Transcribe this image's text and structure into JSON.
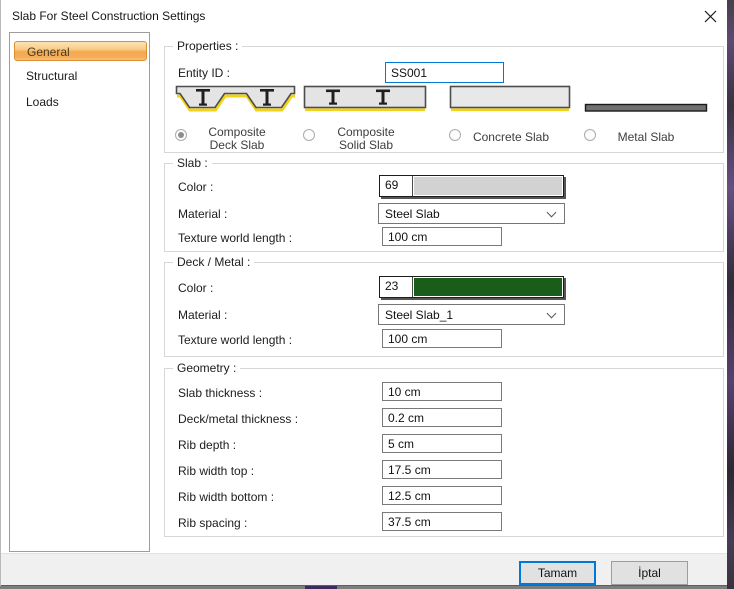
{
  "window": {
    "title": "Slab For Steel Construction Settings"
  },
  "sidebar": {
    "items": [
      {
        "label": "General",
        "selected": true
      },
      {
        "label": "Structural",
        "selected": false
      },
      {
        "label": "Loads",
        "selected": false
      }
    ]
  },
  "properties": {
    "legend": "Properties :",
    "entity_id_label": "Entity ID :",
    "entity_id_value": "SS001",
    "slab_types": [
      {
        "label_lines": [
          "Composite",
          "Deck Slab"
        ],
        "selected": true
      },
      {
        "label_lines": [
          "Composite",
          "Solid Slab"
        ],
        "selected": false
      },
      {
        "label_lines": [
          "Concrete Slab"
        ],
        "selected": false
      },
      {
        "label_lines": [
          "Metal Slab"
        ],
        "selected": false
      }
    ]
  },
  "slab": {
    "legend": "Slab :",
    "color_label": "Color :",
    "color_index": "69",
    "color_hex": "#d2d2d2",
    "material_label": "Material :",
    "material_value": "Steel Slab",
    "texture_label": "Texture world length :",
    "texture_value": "100 cm"
  },
  "deck_metal": {
    "legend": "Deck / Metal :",
    "color_label": "Color :",
    "color_index": "23",
    "color_hex": "#1a5c1a",
    "material_label": "Material :",
    "material_value": "Steel Slab_1",
    "texture_label": "Texture world length :",
    "texture_value": "100 cm"
  },
  "geometry": {
    "legend": "Geometry :",
    "rows": [
      {
        "label": "Slab thickness :",
        "value": "10 cm"
      },
      {
        "label": "Deck/metal thickness :",
        "value": "0.2 cm"
      },
      {
        "label": "Rib depth :",
        "value": "5 cm"
      },
      {
        "label": "Rib width top :",
        "value": "17.5 cm"
      },
      {
        "label": "Rib width bottom :",
        "value": "12.5 cm"
      },
      {
        "label": "Rib spacing :",
        "value": "37.5 cm"
      }
    ]
  },
  "footer": {
    "ok_label": "Tamam",
    "cancel_label": "İptal"
  }
}
